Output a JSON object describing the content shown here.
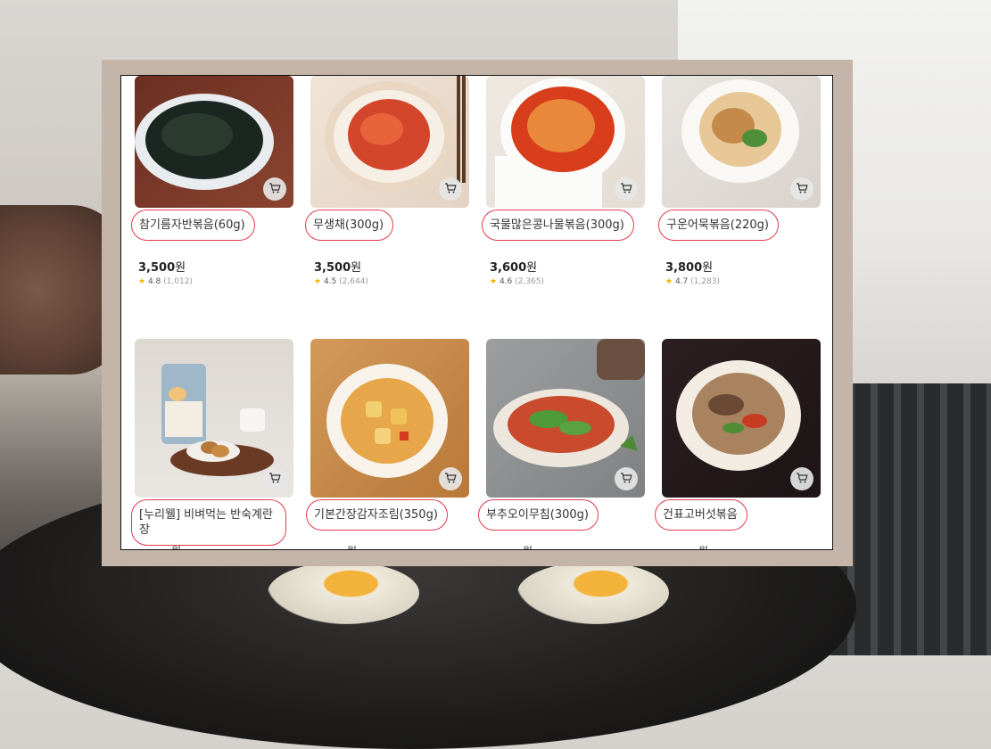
{
  "products": [
    {
      "name": "참기름자반볶음(60g)",
      "price": "3,500",
      "currency": "원",
      "rating": "4.8",
      "reviews": "(1,012)"
    },
    {
      "name": "무생채(300g)",
      "price": "3,500",
      "currency": "원",
      "rating": "4.5",
      "reviews": "(2,644)"
    },
    {
      "name": "국물많은콩나물볶음(300g)",
      "price": "3,600",
      "currency": "원",
      "rating": "4.6",
      "reviews": "(2,365)"
    },
    {
      "name": "구운어묵볶음(220g)",
      "price": "3,800",
      "currency": "원",
      "rating": "4.7",
      "reviews": "(1,283)"
    },
    {
      "name": "[누리웰] 비벼먹는 반숙계란장",
      "price": "",
      "currency": "원"
    },
    {
      "name": "기본간장감자조림(350g)",
      "price": "",
      "currency": "원"
    },
    {
      "name": "부추오이무침(300g)",
      "price": "",
      "currency": "원"
    },
    {
      "name": "건표고버섯볶음",
      "price": "",
      "currency": "원"
    }
  ],
  "icons": {
    "cart": "cart-icon",
    "star": "star-icon"
  },
  "colors": {
    "highlight": "#e23a4a",
    "star": "#f5b400"
  }
}
